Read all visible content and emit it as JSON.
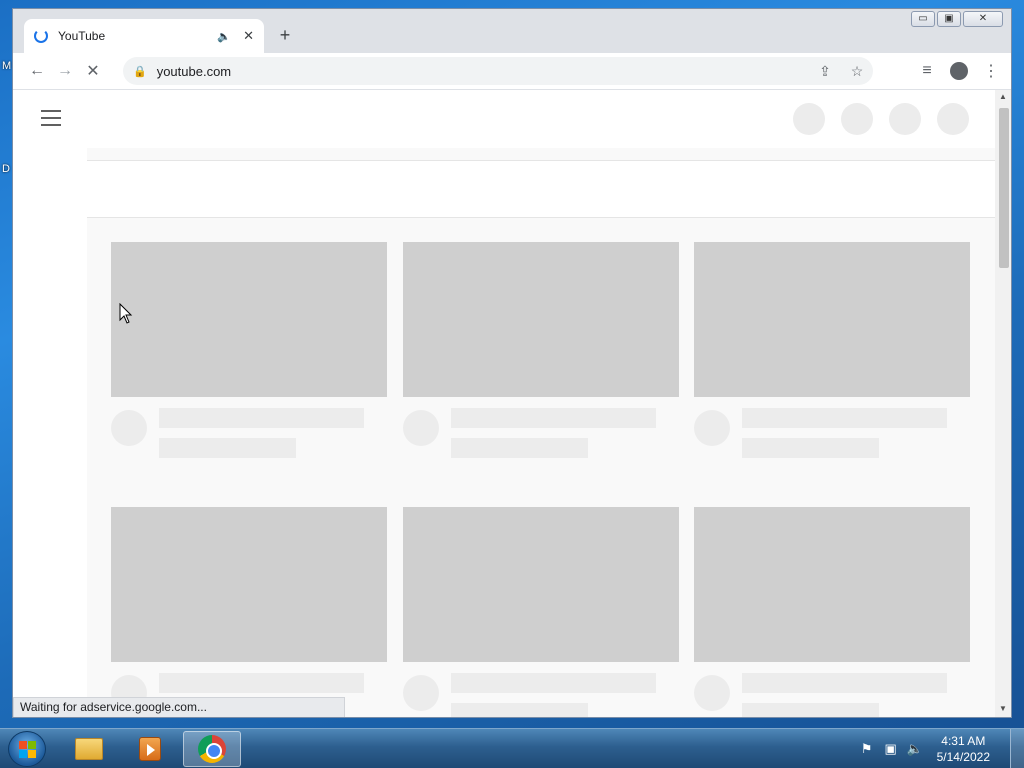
{
  "desktop": {
    "label_m": "M",
    "label_d": "D"
  },
  "window": {
    "minimize": "▭",
    "maximize": "▣",
    "close": "✕"
  },
  "tab": {
    "title": "YouTube",
    "audio_icon": "🔈",
    "close_icon": "✕"
  },
  "newtab_icon": "+",
  "toolbar": {
    "back": "←",
    "forward": "→",
    "stop": "✕",
    "lock": "🔒",
    "url": "youtube.com",
    "share": "⇪",
    "bookmark": "☆",
    "media": "≡",
    "menu": "⋮"
  },
  "status_text": "Waiting for adservice.google.com...",
  "taskbar": {
    "time": "4:31 AM",
    "date": "5/14/2022"
  },
  "colors": {
    "accent": "#1a73e8",
    "skeleton": "#cfcfcf",
    "skeleton_light": "#ececec"
  }
}
